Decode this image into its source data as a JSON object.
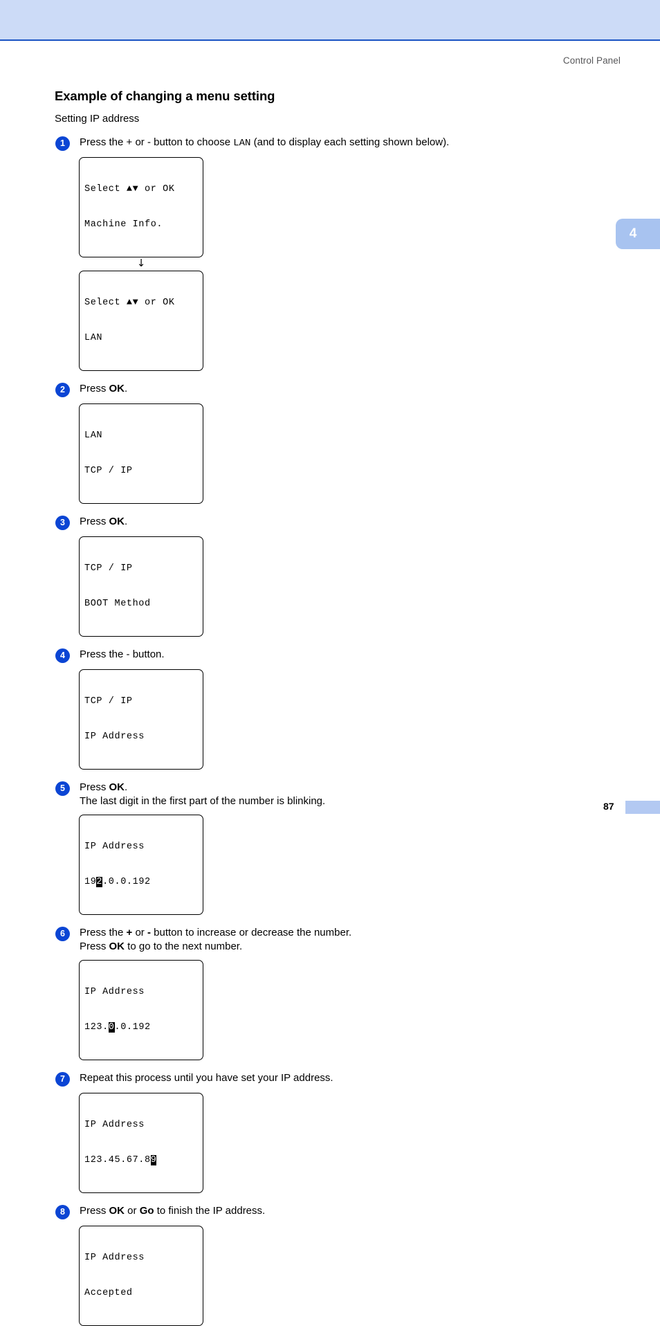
{
  "header": {
    "running_head": "Control Panel"
  },
  "chapter_tab": {
    "number": "4"
  },
  "section": {
    "title": "Example of changing a menu setting",
    "subtitle": "Setting IP address"
  },
  "steps": [
    {
      "number": "1",
      "text_parts": [
        {
          "t": "Press the + or - button to choose ",
          "style": "plain"
        },
        {
          "t": "LAN",
          "style": "mono"
        },
        {
          "t": " (and to display each setting shown below).",
          "style": "plain"
        }
      ]
    },
    {
      "number": "2",
      "text_parts": [
        {
          "t": "Press ",
          "style": "plain"
        },
        {
          "t": "OK",
          "style": "bold"
        },
        {
          "t": ".",
          "style": "plain"
        }
      ]
    },
    {
      "number": "3",
      "text_parts": [
        {
          "t": "Press ",
          "style": "plain"
        },
        {
          "t": "OK",
          "style": "bold"
        },
        {
          "t": ".",
          "style": "plain"
        }
      ]
    },
    {
      "number": "4",
      "text_parts": [
        {
          "t": "Press the - button.",
          "style": "plain"
        }
      ]
    },
    {
      "number": "5",
      "line1_parts": [
        {
          "t": "Press ",
          "style": "plain"
        },
        {
          "t": "OK",
          "style": "bold"
        },
        {
          "t": ".",
          "style": "plain"
        }
      ],
      "line2_parts": [
        {
          "t": "The last digit in the first part of the number is blinking.",
          "style": "plain"
        }
      ]
    },
    {
      "number": "6",
      "line1_parts": [
        {
          "t": "Press the ",
          "style": "plain"
        },
        {
          "t": "+",
          "style": "bold"
        },
        {
          "t": " or ",
          "style": "plain"
        },
        {
          "t": "-",
          "style": "bold"
        },
        {
          "t": " button to increase or decrease the number.",
          "style": "plain"
        }
      ],
      "line2_parts": [
        {
          "t": "Press ",
          "style": "plain"
        },
        {
          "t": "OK",
          "style": "bold"
        },
        {
          "t": " to go to the next number.",
          "style": "plain"
        }
      ]
    },
    {
      "number": "7",
      "text_parts": [
        {
          "t": "Repeat this process until you have set your IP address.",
          "style": "plain"
        }
      ]
    },
    {
      "number": "8",
      "text_parts": [
        {
          "t": "Press ",
          "style": "plain"
        },
        {
          "t": "OK",
          "style": "bold"
        },
        {
          "t": " or ",
          "style": "plain"
        },
        {
          "t": "Go",
          "style": "bold"
        },
        {
          "t": " to finish the IP address.",
          "style": "plain"
        }
      ]
    }
  ],
  "lcd_displays": {
    "d1": {
      "line1": "Select ▲▼ or OK",
      "line2": "Machine Info."
    },
    "arrow": "↓",
    "d2": {
      "line1": "Select ▲▼ or OK",
      "line2": "LAN"
    },
    "d3": {
      "line1": "LAN",
      "line2": "TCP / IP"
    },
    "d4": {
      "line1": "TCP / IP",
      "line2": "BOOT Method"
    },
    "d5": {
      "line1": "TCP / IP",
      "line2": "IP Address"
    },
    "d6": {
      "line1": "IP Address",
      "line2_pre": "19",
      "line2_blink": "2",
      "line2_post": ".0.0.192"
    },
    "d7": {
      "line1": "IP Address",
      "line2_pre": "123.",
      "line2_blink": "0",
      "line2_post": ".0.192"
    },
    "d8": {
      "line1": "IP Address",
      "line2_pre": "123.45.67.8",
      "line2_blink": "9",
      "line2_post": ""
    },
    "d9": {
      "line1": "IP Address",
      "line2": "Accepted"
    }
  },
  "footer": {
    "page_number": "87"
  },
  "colors": {
    "banner": "#ccdbf7",
    "banner_rule": "#1a54c4",
    "step_circle": "#0b45d4",
    "chapter_tab": "#a8c3f0",
    "footer_bar": "#b3c9f2",
    "running_head": "#58585a"
  }
}
